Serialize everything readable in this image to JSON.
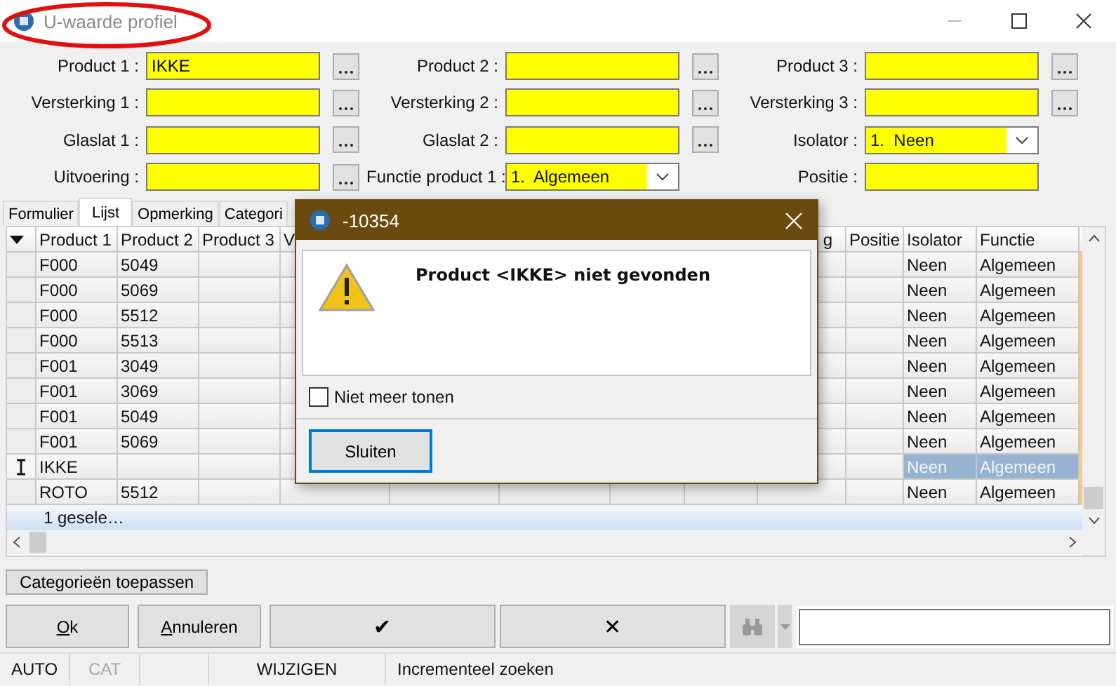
{
  "window": {
    "title": "U-waarde profiel"
  },
  "form": {
    "fields": [
      {
        "label": "Product 1 :",
        "value": "IKKE",
        "kind": "lookup"
      },
      {
        "label": "Product 2 :",
        "kind": "lookup"
      },
      {
        "label": "Product 3 :",
        "kind": "lookup"
      },
      {
        "label": "Versterking 1 :",
        "kind": "lookup"
      },
      {
        "label": "Versterking 2 :",
        "kind": "lookup"
      },
      {
        "label": "Versterking 3 :",
        "kind": "lookup"
      },
      {
        "label": "Glaslat 1 :",
        "kind": "lookup"
      },
      {
        "label": "Glaslat 2 :",
        "kind": "lookup"
      },
      {
        "label": "Isolator :",
        "value": "1.  Neen",
        "kind": "dropdown"
      },
      {
        "label": "Uitvoering :",
        "kind": "lookup"
      },
      {
        "label": "Functie product 1 :",
        "value": "1.  Algemeen",
        "kind": "dropdown"
      },
      {
        "label": "Positie :",
        "kind": "text"
      }
    ]
  },
  "tabs": [
    {
      "label": "Formulier",
      "selected": false
    },
    {
      "label": "Lijst",
      "selected": true
    },
    {
      "label": "Opmerking",
      "selected": false
    },
    {
      "label": "Categori",
      "selected": false
    }
  ],
  "table": {
    "columns": [
      "Product 1",
      "Product 2",
      "Product 3",
      "V",
      "g",
      "Positie",
      "Isolator",
      "Functie"
    ],
    "rows": [
      {
        "cells": [
          "F000",
          "5049",
          "Neen",
          "Algemeen"
        ],
        "selected": false
      },
      {
        "cells": [
          "F000",
          "5069",
          "Neen",
          "Algemeen"
        ],
        "selected": false
      },
      {
        "cells": [
          "F000",
          "5512",
          "Neen",
          "Algemeen"
        ],
        "selected": false
      },
      {
        "cells": [
          "F000",
          "5513",
          "Neen",
          "Algemeen"
        ],
        "selected": false
      },
      {
        "cells": [
          "F001",
          "3049",
          "Neen",
          "Algemeen"
        ],
        "selected": false
      },
      {
        "cells": [
          "F001",
          "3069",
          "Neen",
          "Algemeen"
        ],
        "selected": false
      },
      {
        "cells": [
          "F001",
          "5049",
          "Neen",
          "Algemeen"
        ],
        "selected": false
      },
      {
        "cells": [
          "F001",
          "5069",
          "Neen",
          "Algemeen"
        ],
        "selected": false
      },
      {
        "cells": [
          "IKKE",
          "",
          "Neen",
          "Algemeen"
        ],
        "selected": true
      },
      {
        "cells": [
          "ROTO",
          "5512",
          "Neen",
          "Algemeen"
        ],
        "selected": false
      }
    ],
    "footer": "1 gesele…"
  },
  "apply_button": "Categorieën toepassen",
  "buttons": [
    {
      "label": "Ok",
      "kind": "text"
    },
    {
      "label": "Annuleren",
      "kind": "text"
    },
    {
      "label": "✔",
      "kind": "glyph"
    },
    {
      "label": "✕",
      "kind": "glyph"
    }
  ],
  "find": {
    "disabled": true
  },
  "status_bar": [
    {
      "text": "AUTO",
      "disabled": false
    },
    {
      "text": "CAT",
      "disabled": true
    },
    {
      "text": "WIJZIGEN",
      "disabled": false
    },
    {
      "text": "Incrementeel zoeken",
      "disabled": false
    }
  ],
  "dialog": {
    "title": "-10354",
    "message": "Product <IKKE> niet gevonden",
    "checkbox": {
      "label": "Niet meer tonen",
      "checked": false
    },
    "button": "Sluiten"
  }
}
